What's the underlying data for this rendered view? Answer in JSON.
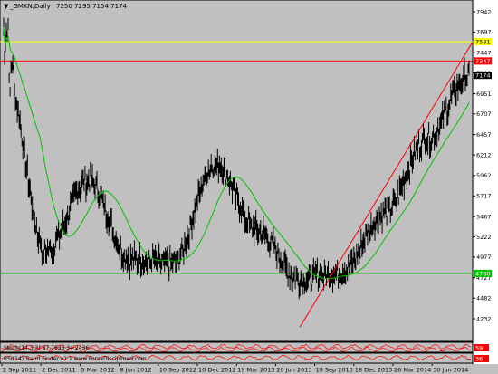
{
  "window": {
    "menu_icon": "triangle-down-icon",
    "symbol": "_GMKN,Daily",
    "ohlc": "7250 7295 7154 7174"
  },
  "price_axis": {
    "labels": [
      "7942",
      "7697",
      "7447",
      "7202",
      "6951",
      "6707",
      "6457",
      "6212",
      "5962",
      "5717",
      "5467",
      "5222",
      "4977",
      "4727",
      "4482",
      "4232"
    ],
    "tags": {
      "yellow": {
        "text": "7581",
        "color": "#ffff00"
      },
      "red": {
        "text": "7347",
        "color": "#ff0000"
      },
      "current": {
        "text": "7174",
        "color": "#000000"
      },
      "green": {
        "text": "4780",
        "color": "#00c000"
      }
    }
  },
  "time_axis": {
    "labels": [
      "2 Sep 2011",
      "2 Dec 2011",
      "5 Mar 2012",
      "8 Jun 2012",
      "10 Sep 2012",
      "10 Dec 2012",
      "19 Mar 2013",
      "20 Jun 2013",
      "18 Sep 2013",
      "18 Dec 2013",
      "26 Mar 2014",
      "30 Jun 2014"
    ]
  },
  "indicator_panels": [
    {
      "label": "Stoch(14,3,3) 37.7636 34.2436",
      "level_text": "59",
      "level_color": "#ff0000"
    },
    {
      "label": "RSI(14) Trend Finder v1.1 www.ForexDisciplined.com",
      "level_text": "36",
      "level_color": "#ff0000"
    }
  ],
  "colors": {
    "chart_bg": "#c0c0c0",
    "candle": "#000000",
    "moving_average": "#00c000",
    "trendline": "#ff0000"
  },
  "chart_data": {
    "type": "line",
    "title": "_GMKN,Daily",
    "ylim": [
      4000,
      8050
    ],
    "x": [
      "2 Sep 2011",
      "2 Dec 2011",
      "5 Mar 2012",
      "8 Jun 2012",
      "10 Sep 2012",
      "10 Dec 2012",
      "19 Mar 2013",
      "20 Jun 2013",
      "18 Sep 2013",
      "18 Dec 2013",
      "26 Mar 2014",
      "30 Jun 2014"
    ],
    "series": [
      {
        "values": [
          7350,
          5050,
          5900,
          4950,
          4900,
          6100,
          5300,
          4700,
          4800,
          5500,
          6400,
          7174
        ]
      }
    ],
    "hlines": [
      {
        "value": 7581,
        "color": "#ffff00"
      },
      {
        "value": 7347,
        "color": "#ff0000"
      },
      {
        "value": 4780,
        "color": "#00c000"
      }
    ],
    "trendline": [
      {
        "x": "20 Jun 2013",
        "y": 4130
      },
      {
        "x": "30 Jun 2014",
        "y": 7560
      }
    ]
  }
}
